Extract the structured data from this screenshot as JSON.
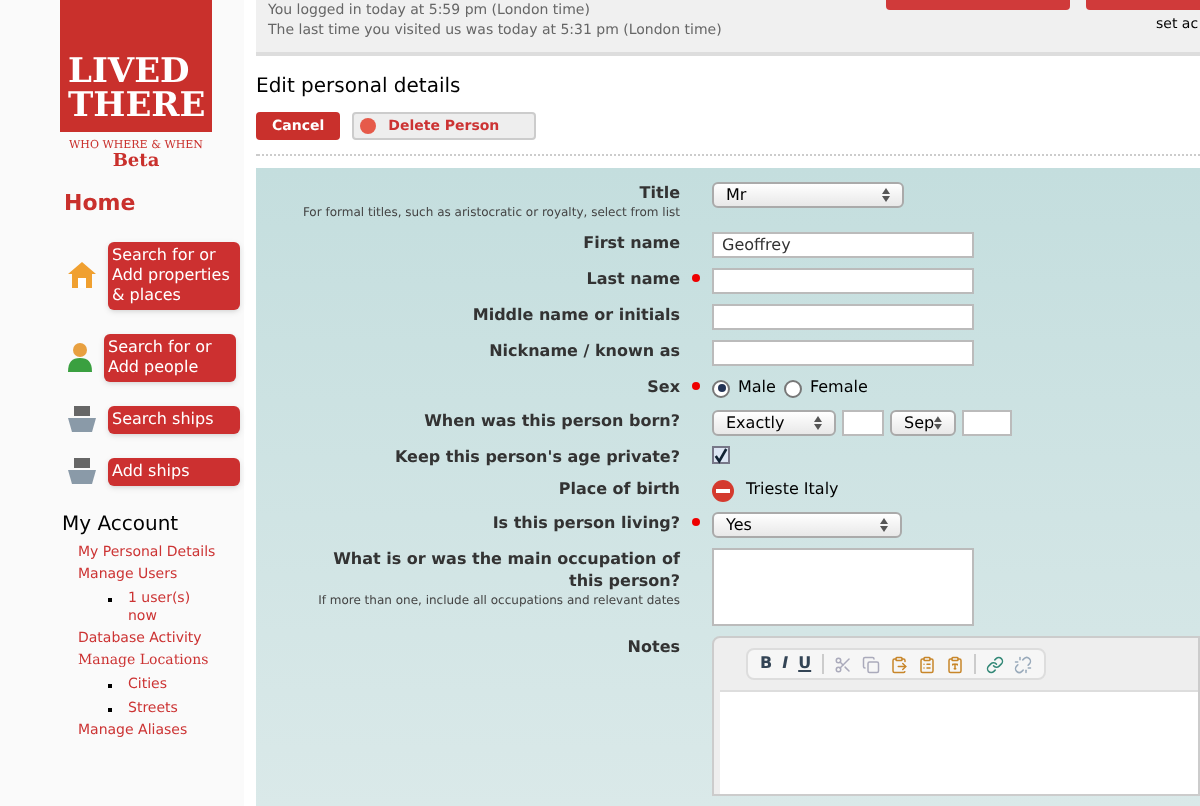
{
  "header": {
    "login_lines": [
      "You logged in today at 5:59 pm (London time)",
      "The last time you visited us was today at 5:31 pm (London time)"
    ],
    "note": "set ac"
  },
  "logo": {
    "title_lines": [
      "LIVED",
      "THERE"
    ],
    "tagline": "WHO WHERE & WHEN",
    "edition": "Beta"
  },
  "sidebar": {
    "home": "Home",
    "actions": [
      {
        "label": "Search for or Add properties & places",
        "kind": "house"
      },
      {
        "label": "Search for or Add people",
        "kind": "person"
      },
      {
        "label": "Search ships",
        "kind": "ship"
      },
      {
        "label": "Add ships",
        "kind": "ship"
      }
    ],
    "account_heading": "My Account",
    "links": [
      {
        "label": "My Personal Details",
        "kind": "sans"
      },
      {
        "label": "Manage Users",
        "kind": "sans",
        "children": [
          {
            "label": "1 user(s) now"
          }
        ]
      },
      {
        "label": "Database Activity",
        "kind": "sans"
      },
      {
        "label": "Manage Locations",
        "kind": "serif",
        "children": [
          {
            "label": "Cities"
          },
          {
            "label": "Streets"
          }
        ]
      },
      {
        "label": "Manage Aliases",
        "kind": "sans"
      }
    ]
  },
  "page": {
    "title": "Edit personal details",
    "buttons": [
      {
        "label": "Cancel",
        "kind": "primary"
      },
      {
        "label": "Delete Person",
        "kind": "danger"
      }
    ]
  },
  "form": {
    "fields": [
      {
        "kind": "select",
        "label": "Title",
        "required": false,
        "value": "Mr",
        "hint": "For formal titles, such as aristocratic or royalty, select from list"
      },
      {
        "kind": "text",
        "label": "First name",
        "required": false,
        "value": "Geoffrey"
      },
      {
        "kind": "text",
        "label": "Last name",
        "required": true
      },
      {
        "kind": "text",
        "label": "Middle name or initials",
        "required": false
      },
      {
        "kind": "text",
        "label": "Nickname / known as",
        "required": false
      },
      {
        "kind": "radio",
        "label": "Sex",
        "required": true,
        "options": [
          {
            "label": "Male",
            "selected": true
          },
          {
            "label": "Female",
            "selected": false
          }
        ]
      },
      {
        "kind": "date",
        "label": "When was this person born?",
        "required": false,
        "precision": "Exactly",
        "month": "Sep"
      },
      {
        "kind": "checkbox",
        "label": "Keep this person's age private?",
        "required": false,
        "checked": true
      },
      {
        "kind": "place",
        "label": "Place of birth",
        "required": false,
        "value": "Trieste Italy"
      },
      {
        "kind": "select",
        "label": "Is this person living?",
        "required": true,
        "value": "Yes"
      },
      {
        "kind": "textarea",
        "label": "What is or was the main occupation of this person?",
        "required": false,
        "hint": "If more than one, include all occupations and relevant dates"
      },
      {
        "kind": "editor",
        "label": "Notes",
        "required": false,
        "format_buttons": [
          "B",
          "I",
          "U"
        ]
      }
    ]
  }
}
